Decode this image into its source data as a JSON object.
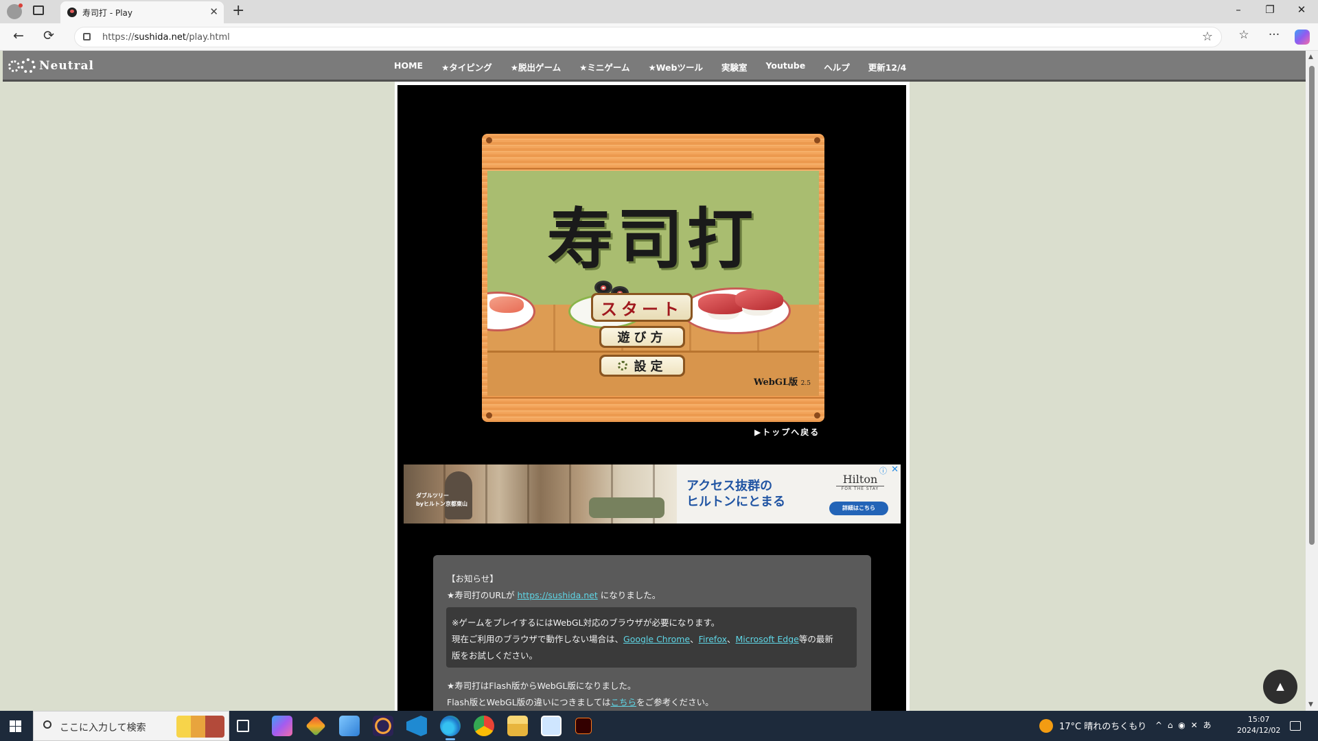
{
  "browser": {
    "tab_title": "寿司打 - Play",
    "url_prefix": "https://",
    "url_host": "sushida.net",
    "url_path": "/play.html",
    "window_controls": {
      "minimize": "–",
      "restore": "❐",
      "close": "✕"
    },
    "nav": {
      "back": "←",
      "reload": "⟳",
      "newtab": "+",
      "tab_close": "✕",
      "star": "☆",
      "favorites": "☆",
      "more": "···"
    }
  },
  "site_nav": {
    "logo_text": "Neutral",
    "items": [
      "HOME",
      "★タイピング",
      "★脱出ゲーム",
      "★ミニゲーム",
      "★Webツール",
      "実験室",
      "Youtube",
      "ヘルプ",
      "更新12/4"
    ]
  },
  "game": {
    "title": "寿司打",
    "start_label": "スタート",
    "howto_label": "遊び方",
    "settings_label": "設定",
    "version_label": "WebGL版",
    "version_number": "2.5",
    "back_link": "▶トップへ戻る"
  },
  "ad": {
    "caption_line1": "ダブルツリー",
    "caption_line2": "byヒルトン京都東山",
    "headline_line1": "アクセス抜群の",
    "headline_line2": "ヒルトンにとまる",
    "logo": "Hilton",
    "logo_sub": "FOR THE STAY",
    "cta": "詳細はこちら",
    "info_icon": "ⓘ",
    "close_icon": "✕"
  },
  "notice": {
    "heading": "【お知らせ】",
    "line1_prefix": "★寿司打のURLが ",
    "line1_link": "https://sushida.net",
    "line1_suffix": " になりました。",
    "box_line1": "※ゲームをプレイするにはWebGL対応のブラウザが必要になります。",
    "box_line2_prefix": "現在ご利用のブラウザで動作しない場合は、",
    "link_chrome": "Google Chrome",
    "sep1": "、",
    "link_firefox": "Firefox",
    "sep2": "、",
    "link_edge": "Microsoft Edge",
    "box_line2_suffix": "等の最新",
    "box_line3": "版をお試しください。",
    "line4": "★寿司打はFlash版からWebGL版になりました。",
    "line5_prefix": "Flash版とWebGL版の違いにつきましては",
    "line5_link": "こちら",
    "line5_suffix": "をご参考ください。"
  },
  "to_top": "▲",
  "taskbar": {
    "search_placeholder": "ここに入力して検索",
    "weather": "17°C  晴れのちくもり",
    "tray_icons": "^  ⌂  ◉  ✕  あ",
    "time": "15:07",
    "date": "2024/12/02"
  }
}
